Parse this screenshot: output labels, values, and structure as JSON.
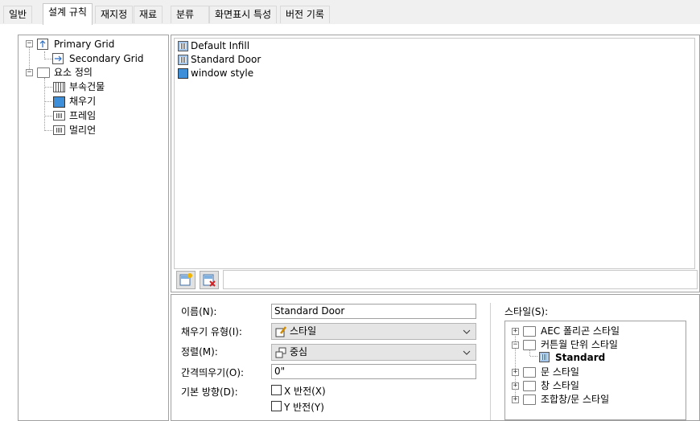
{
  "tabs": [
    "일반",
    "설계 규칙",
    "재지정",
    "재료",
    "분류",
    "화면표시 특성",
    "버전 기록"
  ],
  "active_tab": "설계 규칙",
  "left_tree": {
    "primary_grid": "Primary Grid",
    "secondary_grid": "Secondary Grid",
    "element_defs": "요소 정의",
    "items": [
      "부속건물",
      "채우기",
      "프레임",
      "멀리언"
    ],
    "selected": "채우기"
  },
  "infill_list": [
    "Default Infill",
    "Standard Door",
    "window style"
  ],
  "form": {
    "name_label": "이름(N):",
    "name_value": "Standard Door",
    "type_label": "채우기 유형(I):",
    "type_value": "스타일",
    "align_label": "정렬(M):",
    "align_value": "중심",
    "offset_label": "간격띄우기(O):",
    "offset_value": "0\"",
    "orient_label": "기본 방향(D):",
    "flip_x": "X 반전(X)",
    "flip_y": "Y 반전(Y)"
  },
  "style_tree": {
    "label": "스타일(S):",
    "items": [
      "AEC 폴리곤 스타일",
      "커튼월 단위 스타일",
      "Standard",
      "문 스타일",
      "창 스타일",
      "조합창/문 스타일"
    ],
    "selected": "Standard"
  },
  "colors": {
    "selection_blue": "#3c8fd8",
    "border": "#a0a0a0"
  }
}
